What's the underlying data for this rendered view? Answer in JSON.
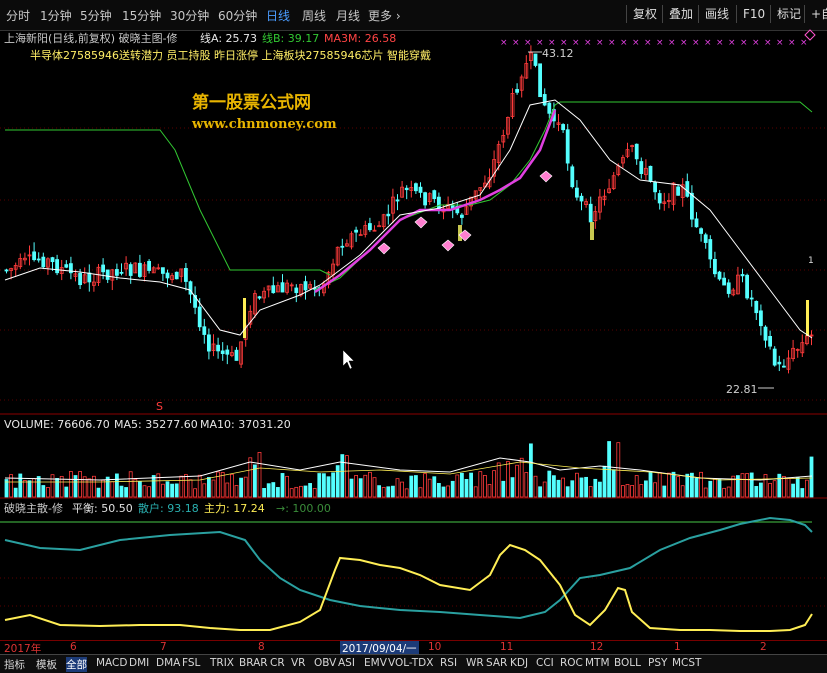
{
  "toolbar": {
    "periods": [
      "分时",
      "1分钟",
      "5分钟",
      "15分钟",
      "30分钟",
      "60分钟",
      "日线",
      "周线",
      "月线",
      "更多 ›"
    ],
    "active_period": "日线",
    "buttons": [
      "复权",
      "叠加",
      "画线",
      "F10",
      "标记",
      "+自"
    ]
  },
  "main_panel": {
    "title": "上海新阳(日线,前复权) 破晓主图-修",
    "line_a_label": "线A: 25.73",
    "line_b_label": "线B: 39.17",
    "ma3m_label": "MA3M: 26.58",
    "concepts": "半导体27585946送转潜力 员工持股 昨日涨停 上海板块27585946芯片 智能穿戴",
    "high_label": "43.12",
    "low_label": "22.81",
    "watermark_title": "第一股票公式网",
    "watermark_url": "www.chnmoney.com",
    "s_marker": "S",
    "right_marker": "1"
  },
  "volume_panel": {
    "label_volume": "VOLUME: 76606.70",
    "label_ma5": "MA5: 35277.60",
    "label_ma10": "MA10: 37031.20"
  },
  "indicator_panel": {
    "name": "破晓主散-修",
    "label_balance": "平衡: 50.50",
    "label_retail": "散户: 93.18",
    "label_main": "主力: 17.24",
    "label_arrow": "→: 100.00"
  },
  "date_axis": {
    "labels": [
      "2017年",
      "6",
      "7",
      "8",
      "10",
      "11",
      "12",
      "1",
      "2"
    ],
    "highlight": "2017/09/04/一"
  },
  "bottom_tabs": [
    "指标",
    "模板",
    "全部",
    "MACD",
    "DMI",
    "DMA",
    "FSL",
    "TRIX",
    "BRAR",
    "CR",
    "VR",
    "OBV",
    "ASI",
    "EMV",
    "VOL-TDX",
    "RSI",
    "WR",
    "SAR",
    "KDJ",
    "CCI",
    "ROC",
    "MTM",
    "BOLL",
    "PSY",
    "MCST"
  ],
  "colors": {
    "up": "#ff3b3b",
    "down": "#54ffff",
    "ma_white": "#ffffff",
    "line_green": "#32c832",
    "line_magenta": "#e040e0",
    "yellow": "#ffee55",
    "teal": "#2aa0a0",
    "accent_blue": "#4a9cff"
  },
  "chart_data": {
    "type": "candlestick",
    "title": "上海新阳(日线,前复权)",
    "ylim": [
      22.81,
      43.12
    ],
    "series": [
      {
        "name": "线A",
        "values": [
          25.73
        ]
      },
      {
        "name": "线B",
        "values": [
          39.17
        ]
      },
      {
        "name": "MA3M",
        "values": [
          26.58
        ]
      },
      {
        "name": "VOLUME",
        "values": [
          76606.7
        ]
      },
      {
        "name": "MA5",
        "values": [
          35277.6
        ]
      },
      {
        "name": "MA10",
        "values": [
          37031.2
        ]
      },
      {
        "name": "平衡",
        "values": [
          50.5
        ]
      },
      {
        "name": "散户",
        "values": [
          93.18
        ]
      },
      {
        "name": "主力",
        "values": [
          17.24
        ]
      }
    ],
    "annotations": [
      "43.12",
      "22.81"
    ]
  }
}
